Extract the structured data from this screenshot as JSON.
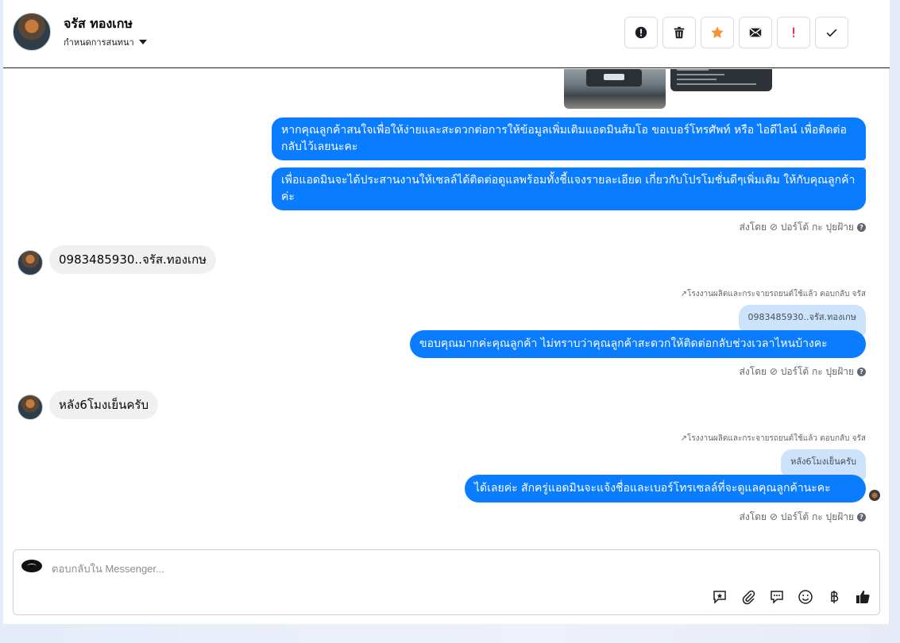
{
  "header": {
    "contact_name": "จรัส ทองเกษ",
    "conversation_label": "กำหนดการสนทนา"
  },
  "toolbar": {
    "actions": [
      "spam-icon",
      "trash-icon",
      "star-icon",
      "mail-icon",
      "important-icon",
      "check-icon"
    ],
    "star_color": "#f7923b",
    "important_color": "#e4332b"
  },
  "messages": {
    "m1": "หากคุณลูกค้าสนใจเพื่อให้ง่ายและสะดวกต่อการให้ข้อมูลเพิ่มเติมแอดมินส้มโอ ขอเบอร์โทรศัพท์ หรือ ไอดีไลน์ เพื่อติดต่อกลับไว้เลยนะคะ",
    "m2": "เพื่อแอดมินจะได้ประสานงานให้เซลล์ได้ติดต่อดูแลพร้อมทั้งชี้แจงรายละเอียด เกี่ยวกับโปรโมชั่นดีๆเพิ่มเติม ให้กับคุณลูกค้าค่ะ",
    "sent_by_1": "ส่งโดย ⊘ ปอร์โต้ กะ ปุยฝ้าย",
    "in1": "0983485930..จรัส.ทองเกษ",
    "replied_1": "↗โรงงานผลิตและกระจายรถยนต์ใช้แล้ว ตอบกลับ จรัส",
    "quoted_1": "0983485930..จรัส.ทองเกษ",
    "m3": "ขอบคุณมากค่ะคุณลูกค้า ไม่ทราบว่าคุณลูกค้าสะดวกให้ติดต่อกลับช่วงเวลาไหนบ้างคะ",
    "sent_by_2": "ส่งโดย ⊘ ปอร์โต้ กะ ปุยฝ้าย",
    "in2": "หลัง6โมงเย็นครับ",
    "replied_2": "↗โรงงานผลิตและกระจายรถยนต์ใช้แล้ว ตอบกลับ จรัส",
    "quoted_2": "หลัง6โมงเย็นครับ",
    "m4": "ได้เลยค่ะ สักครู่แอดมินจะแจ้งชื่อและเบอร์โทรเซลล์ที่จะดูแลคุณลูกค้านะคะ",
    "sent_by_3": "ส่งโดย ⊘ ปอร์โต้ กะ ปุยฝ้าย"
  },
  "composer": {
    "placeholder": "ตอบกลับใน Messenger...",
    "tools": [
      "saved-reply-icon",
      "attach-icon",
      "comment-icon",
      "emoji-icon",
      "baht-icon",
      "like-icon"
    ]
  },
  "colors": {
    "outgoing_bubble": "#0a7cff",
    "incoming_bubble": "#f0f0f0",
    "quoted_bubble": "#cde2fb"
  }
}
